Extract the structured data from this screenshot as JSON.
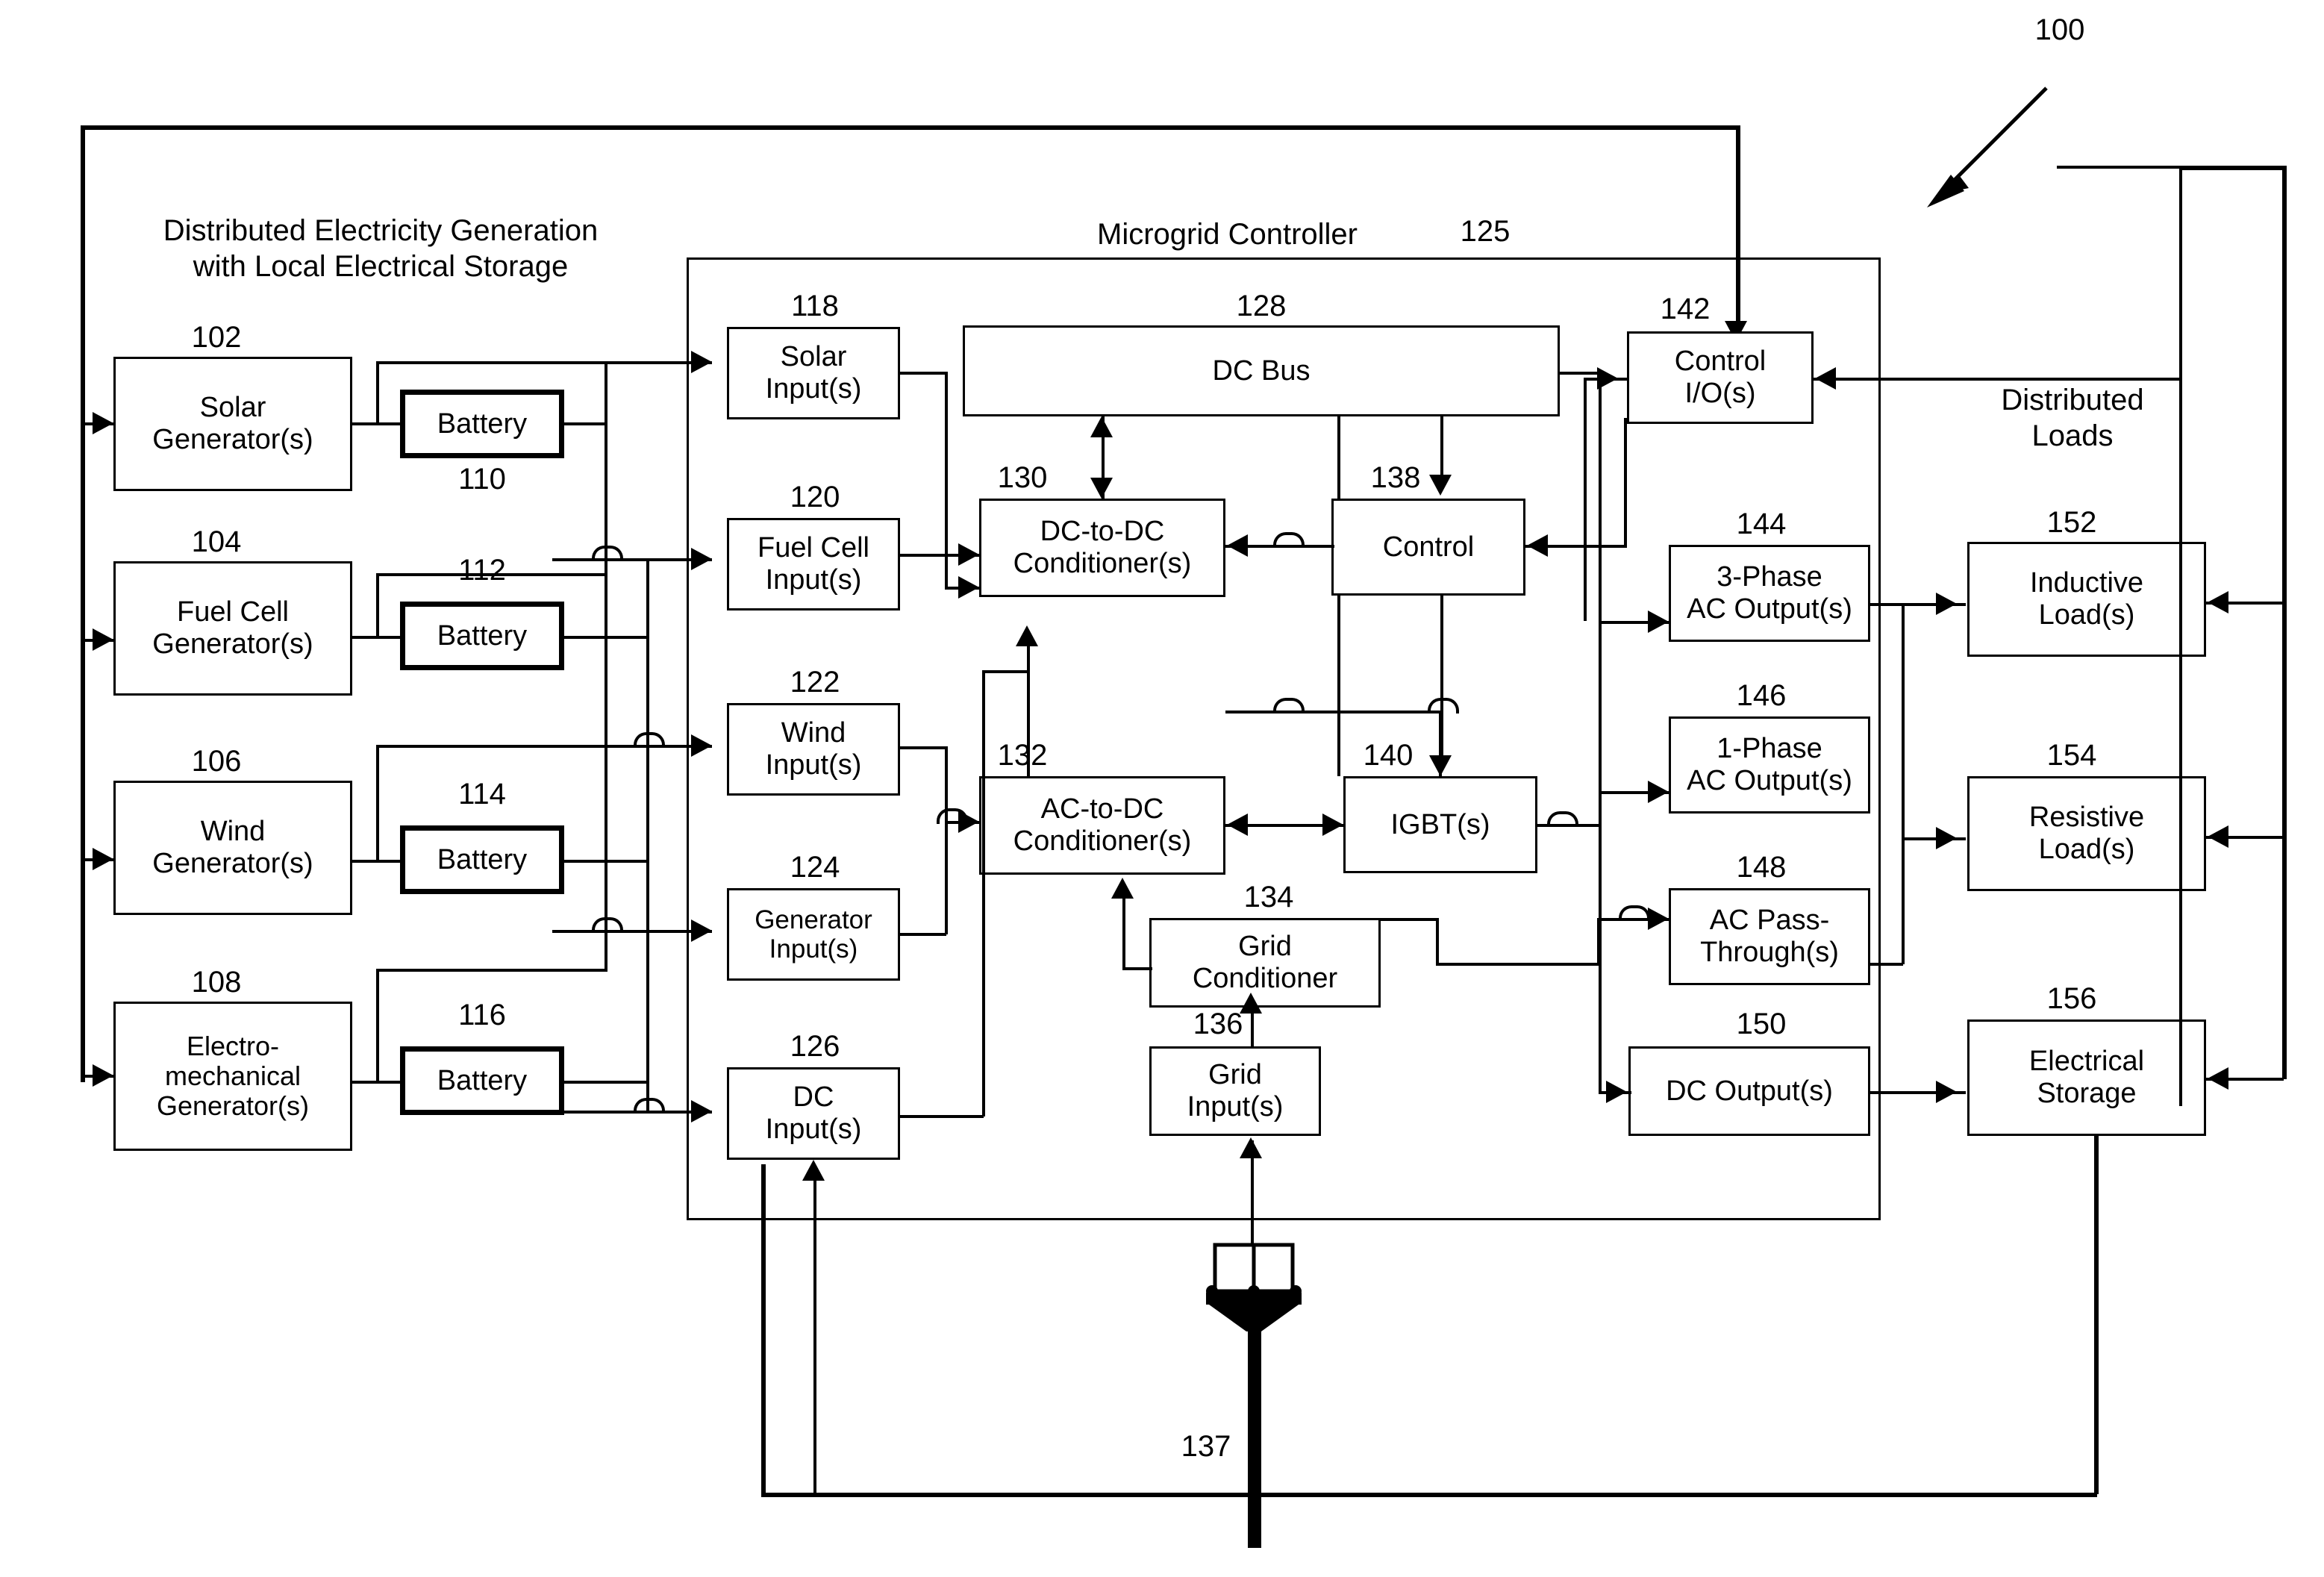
{
  "figure": {
    "number": "100"
  },
  "sections": {
    "generation_caption": "Distributed Electricity Generation\nwith Local Electrical Storage",
    "controller_caption": "Microgrid Controller",
    "controller_number": "125",
    "loads_caption": "Distributed\nLoads"
  },
  "generators": [
    {
      "num": "102",
      "label": "Solar\nGenerator(s)"
    },
    {
      "num": "104",
      "label": "Fuel Cell\nGenerator(s)"
    },
    {
      "num": "106",
      "label": "Wind\nGenerator(s)"
    },
    {
      "num": "108",
      "label": "Electro-\nmechanical\nGenerator(s)"
    }
  ],
  "batteries": [
    {
      "num": "110",
      "label": "Battery"
    },
    {
      "num": "112",
      "label": "Battery"
    },
    {
      "num": "114",
      "label": "Battery"
    },
    {
      "num": "116",
      "label": "Battery"
    }
  ],
  "inputs": [
    {
      "num": "118",
      "label": "Solar\nInput(s)"
    },
    {
      "num": "120",
      "label": "Fuel Cell\nInput(s)"
    },
    {
      "num": "122",
      "label": "Wind\nInput(s)"
    },
    {
      "num": "124",
      "label": "Generator\nInput(s)"
    },
    {
      "num": "126",
      "label": "DC\nInput(s)"
    }
  ],
  "core": [
    {
      "num": "128",
      "label": "DC Bus"
    },
    {
      "num": "130",
      "label": "DC-to-DC\nConditioner(s)"
    },
    {
      "num": "132",
      "label": "AC-to-DC\nConditioner(s)"
    },
    {
      "num": "134",
      "label": "Grid\nConditioner"
    },
    {
      "num": "136",
      "label": "Grid\nInput(s)"
    },
    {
      "num": "138",
      "label": "Control"
    },
    {
      "num": "140",
      "label": "IGBT(s)"
    },
    {
      "num": "142",
      "label": "Control\nI/O(s)"
    }
  ],
  "outputs": [
    {
      "num": "144",
      "label": "3-Phase\nAC Output(s)"
    },
    {
      "num": "146",
      "label": "1-Phase\nAC Output(s)"
    },
    {
      "num": "148",
      "label": "AC Pass-\nThrough(s)"
    },
    {
      "num": "150",
      "label": "DC Output(s)"
    }
  ],
  "loads": [
    {
      "num": "152",
      "label": "Inductive\nLoad(s)"
    },
    {
      "num": "154",
      "label": "Resistive\nLoad(s)"
    },
    {
      "num": "156",
      "label": "Electrical\nStorage"
    }
  ],
  "grid_connection": {
    "num": "137",
    "icon": "utility-pole-icon"
  },
  "colors": {
    "line": "#000000",
    "background": "#ffffff"
  }
}
